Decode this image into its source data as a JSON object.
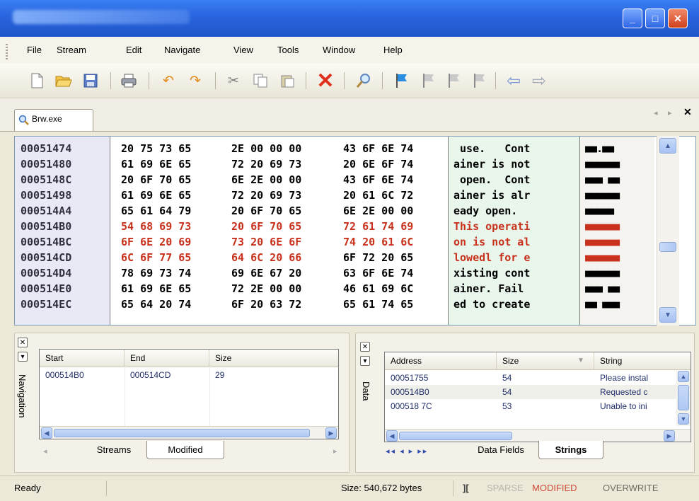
{
  "menu": [
    "File",
    "Stream",
    "Edit",
    "Navigate",
    "View",
    "Tools",
    "Window",
    "Help"
  ],
  "doc_tab": {
    "label": "Brw.exe"
  },
  "hex_rows": [
    {
      "addr": "00051474",
      "h1": "20 75 73 65",
      "h2": "2E 00 00 00",
      "h3": "43 6F 6E 74",
      "ascii": " use.   Cont",
      "blk": "■■.■■"
    },
    {
      "addr": "00051480",
      "h1": "61 69 6E 65",
      "h2": "72 20 69 73",
      "h3": "20 6E 6F 74",
      "ascii": "ainer is not",
      "blk": "■■■■■■"
    },
    {
      "addr": "0005148C",
      "h1": "20 6F 70 65",
      "h2": "6E 2E 00 00",
      "h3": "43 6F 6E 74",
      "ascii": " open.  Cont",
      "blk": "■■■ ■■"
    },
    {
      "addr": "00051498",
      "h1": "61 69 6E 65",
      "h2": "72 20 69 73",
      "h3": "20 61 6C 72",
      "ascii": "ainer is alr",
      "blk": "■■■■■■"
    },
    {
      "addr": "000514A4",
      "h1": "65 61 64 79",
      "h2": "20 6F 70 65",
      "h3": "6E 2E 00 00",
      "ascii": "eady open.",
      "blk": "■■■■■"
    },
    {
      "addr": "000514B0",
      "h1": "54 68 69 73",
      "h2": "20 6F 70 65",
      "h3": "72 61 74 69",
      "ascii": "This operati",
      "blk": "■■■■■■",
      "modified": true
    },
    {
      "addr": "000514BC",
      "h1": "6F 6E 20 69",
      "h2": "73 20 6E 6F",
      "h3": "74 20 61 6C",
      "ascii": "on is not al",
      "blk": "■■■■■■",
      "modified": true
    },
    {
      "addr": "000514CD",
      "h1": "6C 6F 77 65",
      "h2": "64 6C 20 66",
      "h3": "6F 72 20 65",
      "ascii": "lowedl for e",
      "blk": "■■■■■■",
      "modified": "partial",
      "current": true
    },
    {
      "addr": "000514D4",
      "h1": "78 69 73 74",
      "h2": "69 6E 67 20",
      "h3": "63 6F 6E 74",
      "ascii": "xisting cont",
      "blk": "■■■■■■"
    },
    {
      "addr": "000514E0",
      "h1": "61 69 6E 65",
      "h2": "72 2E 00 00",
      "h3": "46 61 69 6C",
      "ascii": "ainer. Fail",
      "blk": "■■■ ■■"
    },
    {
      "addr": "000514EC",
      "h1": "65 64 20 74",
      "h2": "6F 20 63 72",
      "h3": "65 61 74 65",
      "ascii": "ed to create",
      "blk": "■■ ■■■"
    }
  ],
  "nav_panel": {
    "label": "Navigation",
    "columns": [
      "Start",
      "End",
      "Size"
    ],
    "rows": [
      {
        "start": "000514B0",
        "end": "000514CD",
        "size": "29"
      }
    ],
    "tabs": [
      "Streams",
      "Modified"
    ]
  },
  "data_panel": {
    "label": "Data",
    "columns": [
      "Address",
      "Size",
      "String"
    ],
    "rows": [
      {
        "address": "00051755",
        "size": "54",
        "string": "Please instal"
      },
      {
        "address": "000514B0",
        "size": "54",
        "string": "Requested c"
      },
      {
        "address": "000518 7C",
        "size": "53",
        "string": "Unable to ini"
      }
    ],
    "tabs": [
      "Data Fields",
      "Strings"
    ]
  },
  "status": {
    "ready": "Ready",
    "size": "Size: 540,672 bytes",
    "sparse": "SPARSE",
    "modified": "MODIFIED",
    "overwrite": "OVERWRITE"
  }
}
